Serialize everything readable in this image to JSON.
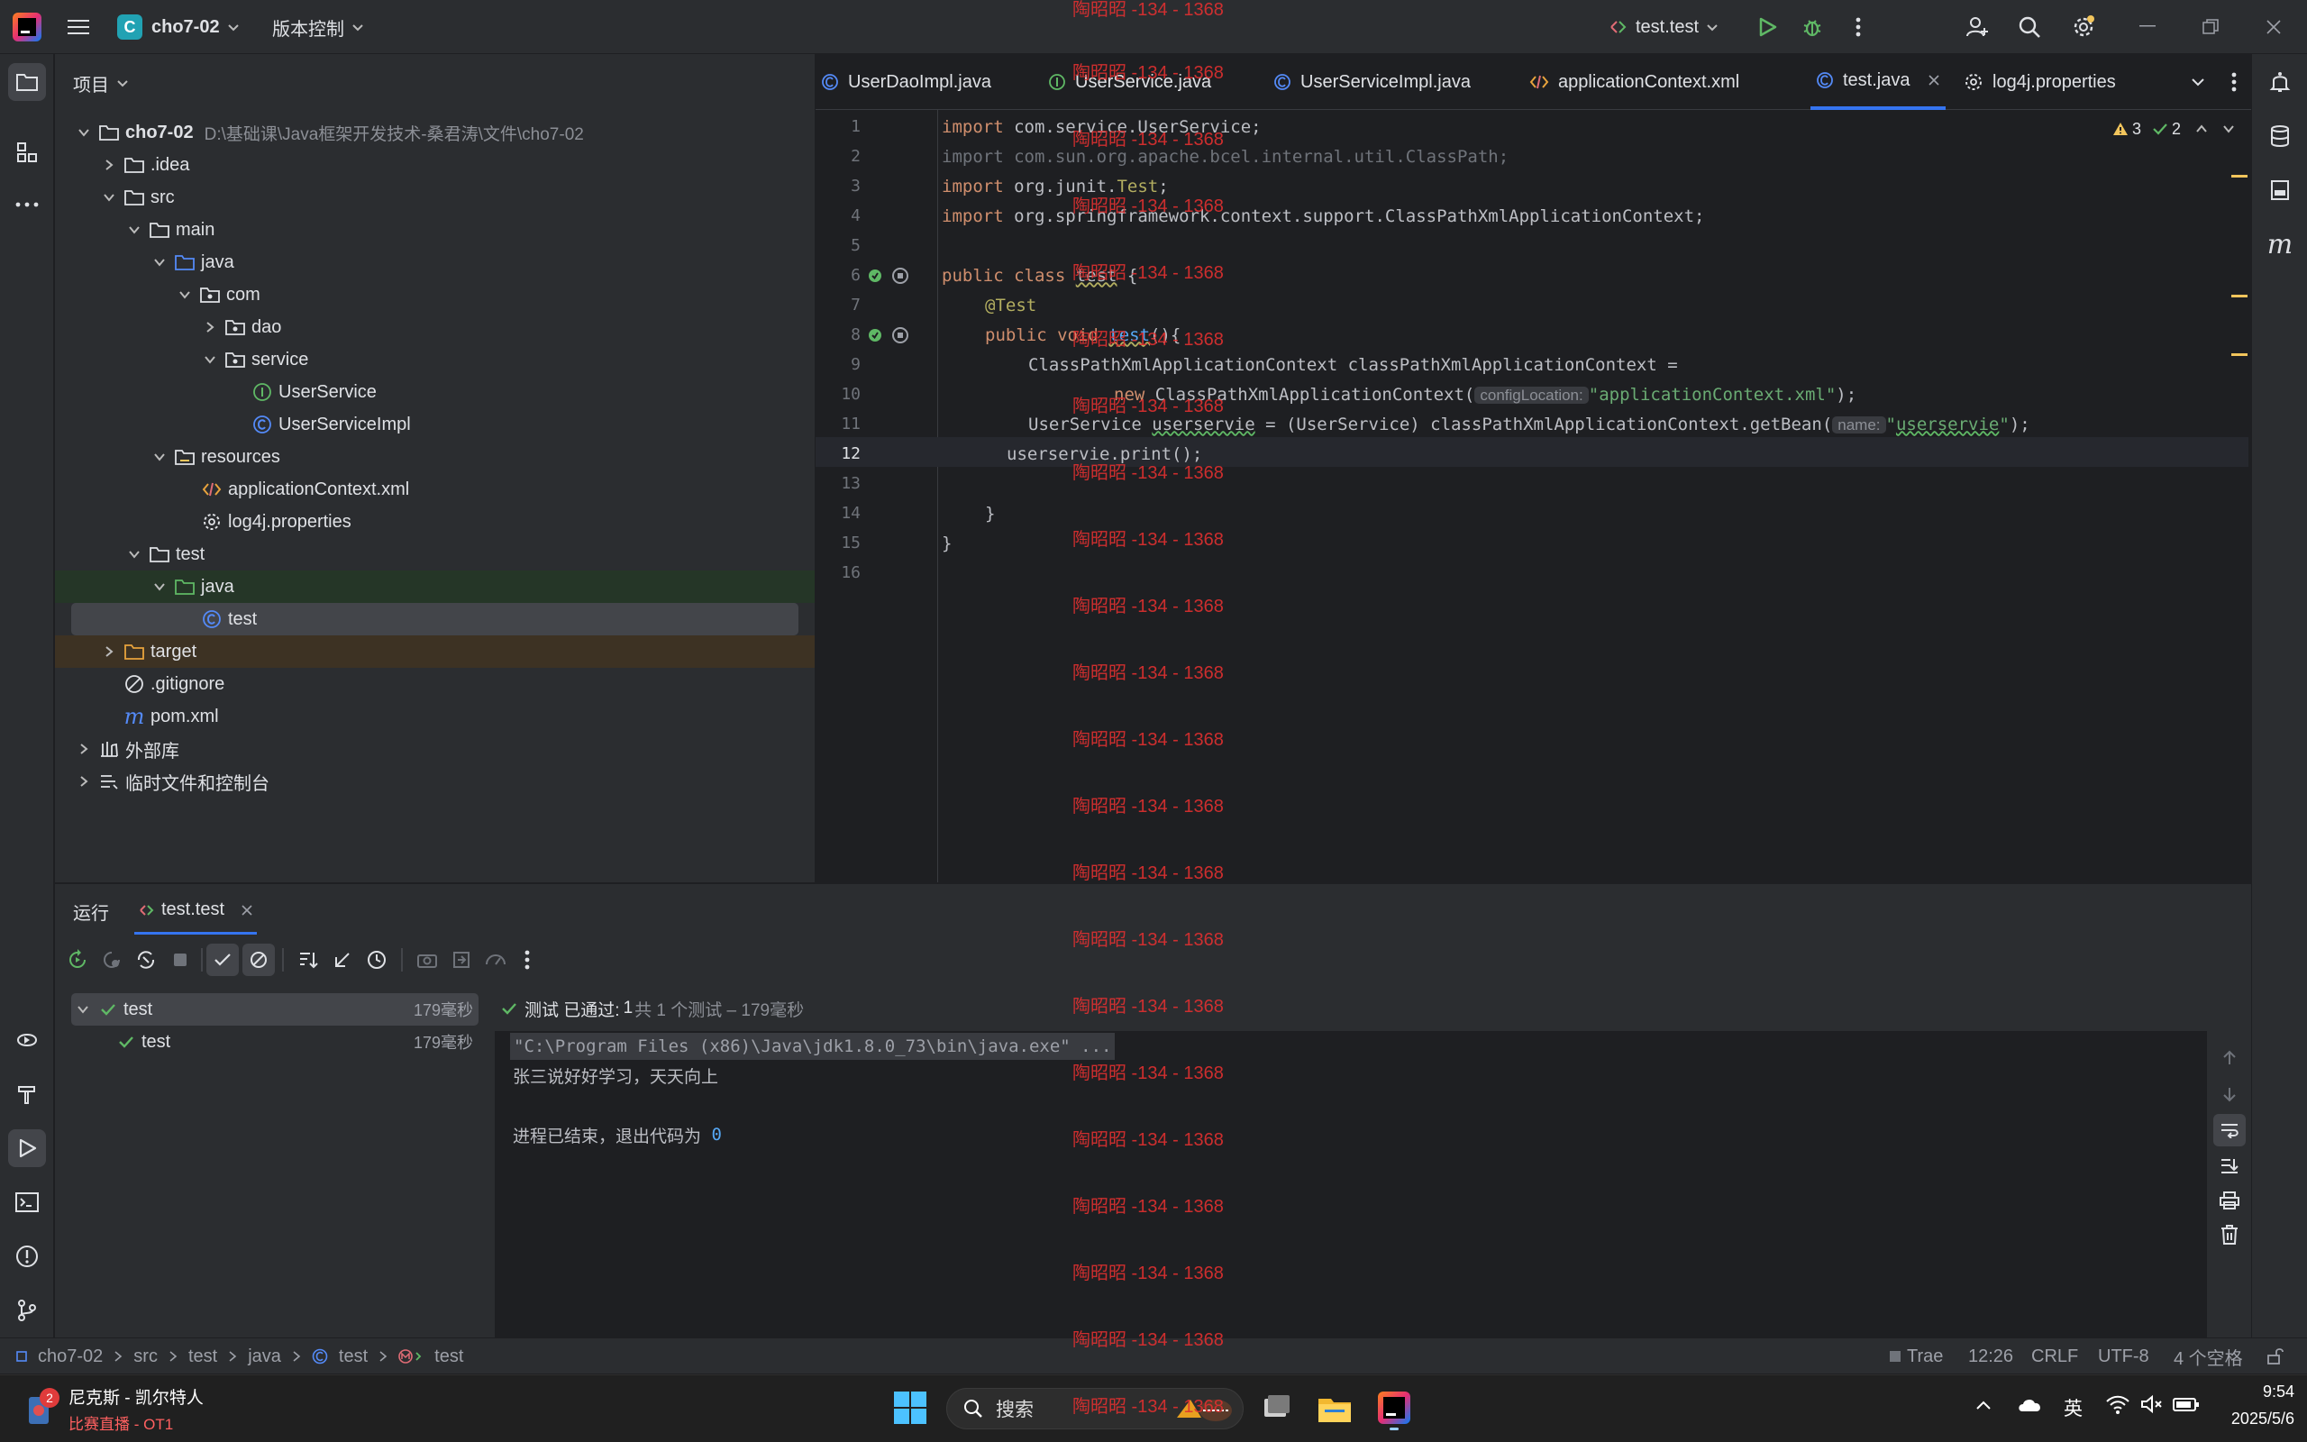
{
  "titlebar": {
    "project_badge": "C",
    "project_name": "cho7-02",
    "vcs_menu": "版本控制",
    "run_config": "test.test"
  },
  "project_panel": {
    "title": "项目",
    "root_name": "cho7-02",
    "root_path": "D:\\基础课\\Java框架开发技术-桑君涛\\文件\\cho7-02",
    "items": [
      {
        "label": ".idea"
      },
      {
        "label": "src"
      },
      {
        "label": "main"
      },
      {
        "label": "java"
      },
      {
        "label": "com"
      },
      {
        "label": "dao"
      },
      {
        "label": "service"
      },
      {
        "label": "UserService"
      },
      {
        "label": "UserServiceImpl"
      },
      {
        "label": "resources"
      },
      {
        "label": "applicationContext.xml"
      },
      {
        "label": "log4j.properties"
      },
      {
        "label": "test"
      },
      {
        "label": "java"
      },
      {
        "label": "test"
      },
      {
        "label": "target"
      },
      {
        "label": ".gitignore"
      },
      {
        "label": "pom.xml"
      },
      {
        "label": "外部库"
      },
      {
        "label": "临时文件和控制台"
      }
    ]
  },
  "tabs": [
    {
      "label": "UserDaoImpl.java"
    },
    {
      "label": "UserService.java"
    },
    {
      "label": "UserServiceImpl.java"
    },
    {
      "label": "applicationContext.xml"
    },
    {
      "label": "test.java"
    },
    {
      "label": "log4j.properties"
    }
  ],
  "editor": {
    "warnings": "3",
    "oks": "2",
    "line_numbers": [
      "1",
      "2",
      "3",
      "4",
      "5",
      "6",
      "7",
      "8",
      "9",
      "10",
      "11",
      "12",
      "13",
      "14",
      "15",
      "16"
    ],
    "l1a": "import ",
    "l1b": "com.service.UserService;",
    "l2": "import com.sun.org.apache.bcel.internal.util.ClassPath;",
    "l3a": "import ",
    "l3b": "org.junit.",
    "l3c": "Test",
    "l3d": ";",
    "l4a": "import ",
    "l4b": "org.springframework.context.support.ClassPathXmlApplicationContext;",
    "l6a": "public class ",
    "l6b": "test",
    "l6c": " {",
    "l7": "@Test",
    "l8a": "public void ",
    "l8b": "test",
    "l8c": "(){",
    "l9": "ClassPathXmlApplicationContext classPathXmlApplicationContext =",
    "l10a": "new ",
    "l10b": "ClassPathXmlApplicationContext(",
    "l10hint": "configLocation:",
    "l10c": "\"applicationContext.xml\"",
    "l10d": ");",
    "l11a": "UserService ",
    "l11b": "userservie",
    "l11c": " = (UserService) classPathXmlApplicationContext.getBean(",
    "l11hint": "name:",
    "l11d": "\"",
    "l11e": "userservie",
    "l11f": "\"",
    "l11g": ");",
    "l12": "userservie.print();",
    "l14": "}",
    "l15": "}"
  },
  "run": {
    "title": "运行",
    "tab_label": "test.test",
    "tree_root": "test",
    "tree_root_time": "179毫秒",
    "tree_child": "test",
    "tree_child_time": "179毫秒",
    "result_label": "测试 已通过:",
    "result_count": "1",
    "result_detail": "共 1 个测试 – 179毫秒",
    "console_cmd": "\"C:\\Program Files (x86)\\Java\\jdk1.8.0_73\\bin\\java.exe\" ...",
    "console_out": "张三说好好学习，天天向上",
    "console_exit_a": "进程已结束，退出代码为 ",
    "console_exit_b": "0"
  },
  "statusbar": {
    "breadcrumb": [
      "cho7-02",
      "src",
      "test",
      "java",
      "test",
      "test"
    ],
    "trae": "Trae",
    "position": "12:26",
    "line_sep": "CRLF",
    "encoding": "UTF-8",
    "indent": "4 个空格"
  },
  "taskbar": {
    "notif_count": "2",
    "media_title": "尼克斯 - 凯尔特人",
    "media_sub": "比赛直播 - OT1",
    "search": "搜索",
    "ime": "英",
    "time": "9:54",
    "date": "2025/5/6"
  },
  "watermark": "陶昭昭 -134 - 1368",
  "colors": {
    "accent": "#3574f0",
    "run_green": "#5fb865",
    "warning": "#f2c55c",
    "watermark": "#e03030"
  }
}
